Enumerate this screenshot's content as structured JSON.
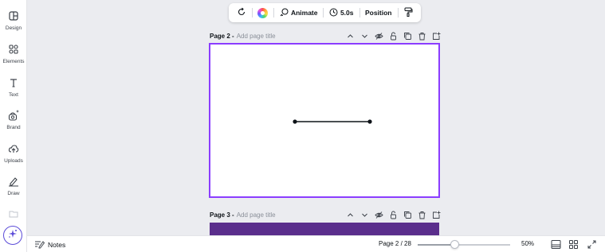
{
  "sidebar": {
    "items": [
      {
        "label": "Design",
        "icon": "design-icon"
      },
      {
        "label": "Elements",
        "icon": "elements-icon"
      },
      {
        "label": "Text",
        "icon": "text-icon"
      },
      {
        "label": "Brand",
        "icon": "brand-icon"
      },
      {
        "label": "Uploads",
        "icon": "uploads-icon"
      },
      {
        "label": "Draw",
        "icon": "draw-icon"
      }
    ],
    "magic_icon": "magic-sparkle-icon"
  },
  "toolbar": {
    "animate_label": "Animate",
    "duration_label": "5.0s",
    "position_label": "Position"
  },
  "pages": [
    {
      "label": "Page 2 -",
      "title_placeholder": "Add page title"
    },
    {
      "label": "Page 3 -",
      "title_placeholder": "Add page title"
    }
  ],
  "bottombar": {
    "notes_label": "Notes",
    "page_count": "Page 2 / 28",
    "zoom_value": "50%",
    "zoom_fraction": 0.4
  },
  "colors": {
    "accent": "#8b3dff",
    "page3_fill": "#5a2e8c",
    "background": "#ebecf0"
  }
}
